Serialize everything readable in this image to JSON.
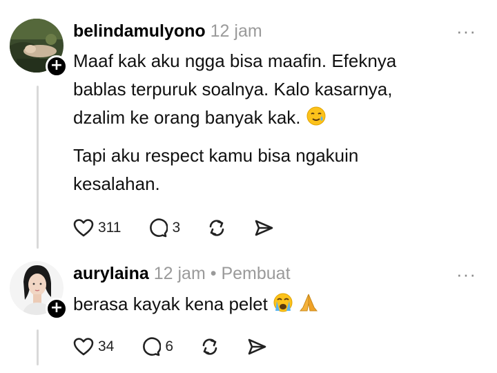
{
  "comments": [
    {
      "username": "belindamulyono",
      "time": "12 jam",
      "lines": [
        "Maaf kak aku ngga bisa maafin. Efeknya",
        "bablas terpuruk soalnya. Kalo kasarnya,",
        "dzalim ke orang banyak kak."
      ],
      "lines2": [
        "Tapi aku respect kamu bisa ngakuin",
        "kesalahan."
      ],
      "likes": "311",
      "replies": "3",
      "more": "···",
      "follow": "+"
    },
    {
      "username": "aurylaina",
      "time": "12 jam",
      "separator": "•",
      "role": "Pembuat",
      "text": "berasa kayak kena pelet",
      "likes": "34",
      "replies": "6",
      "more": "···",
      "follow": "+"
    }
  ],
  "icons": [
    "heart-icon",
    "comment-icon",
    "repost-icon",
    "share-icon",
    "more-icon",
    "follow-plus-icon",
    "tear-smile-emoji",
    "crying-emoji",
    "pray-emoji"
  ],
  "colors": {
    "meta": "#9a9a9a",
    "thread": "#d9d9d9",
    "text": "#111111"
  }
}
